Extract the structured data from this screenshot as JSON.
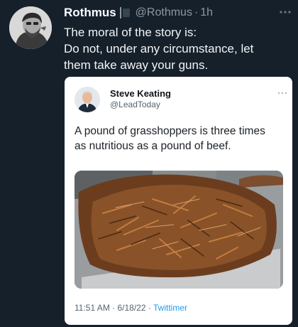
{
  "tweet": {
    "author_name": "Rothmus",
    "author_handle": "@Rothmus",
    "separator": "·",
    "time": "1h",
    "lines": [
      "The moral of the story is:",
      "Do not, under any circumstance, let",
      "them take away your guns."
    ]
  },
  "quoted": {
    "author_name": "Steve Keating",
    "author_handle": "@LeadToday",
    "lines": [
      "A pound of grasshoppers is three times",
      "as nutritious as a pound of beef."
    ],
    "time": "11:51 AM",
    "date": "6/18/22",
    "dot": "·",
    "source": "Twittimer"
  },
  "icons": {
    "more": "more-icon",
    "flag": "flag-icon"
  },
  "colors": {
    "background": "#15202b",
    "link": "#1d9bf0"
  }
}
